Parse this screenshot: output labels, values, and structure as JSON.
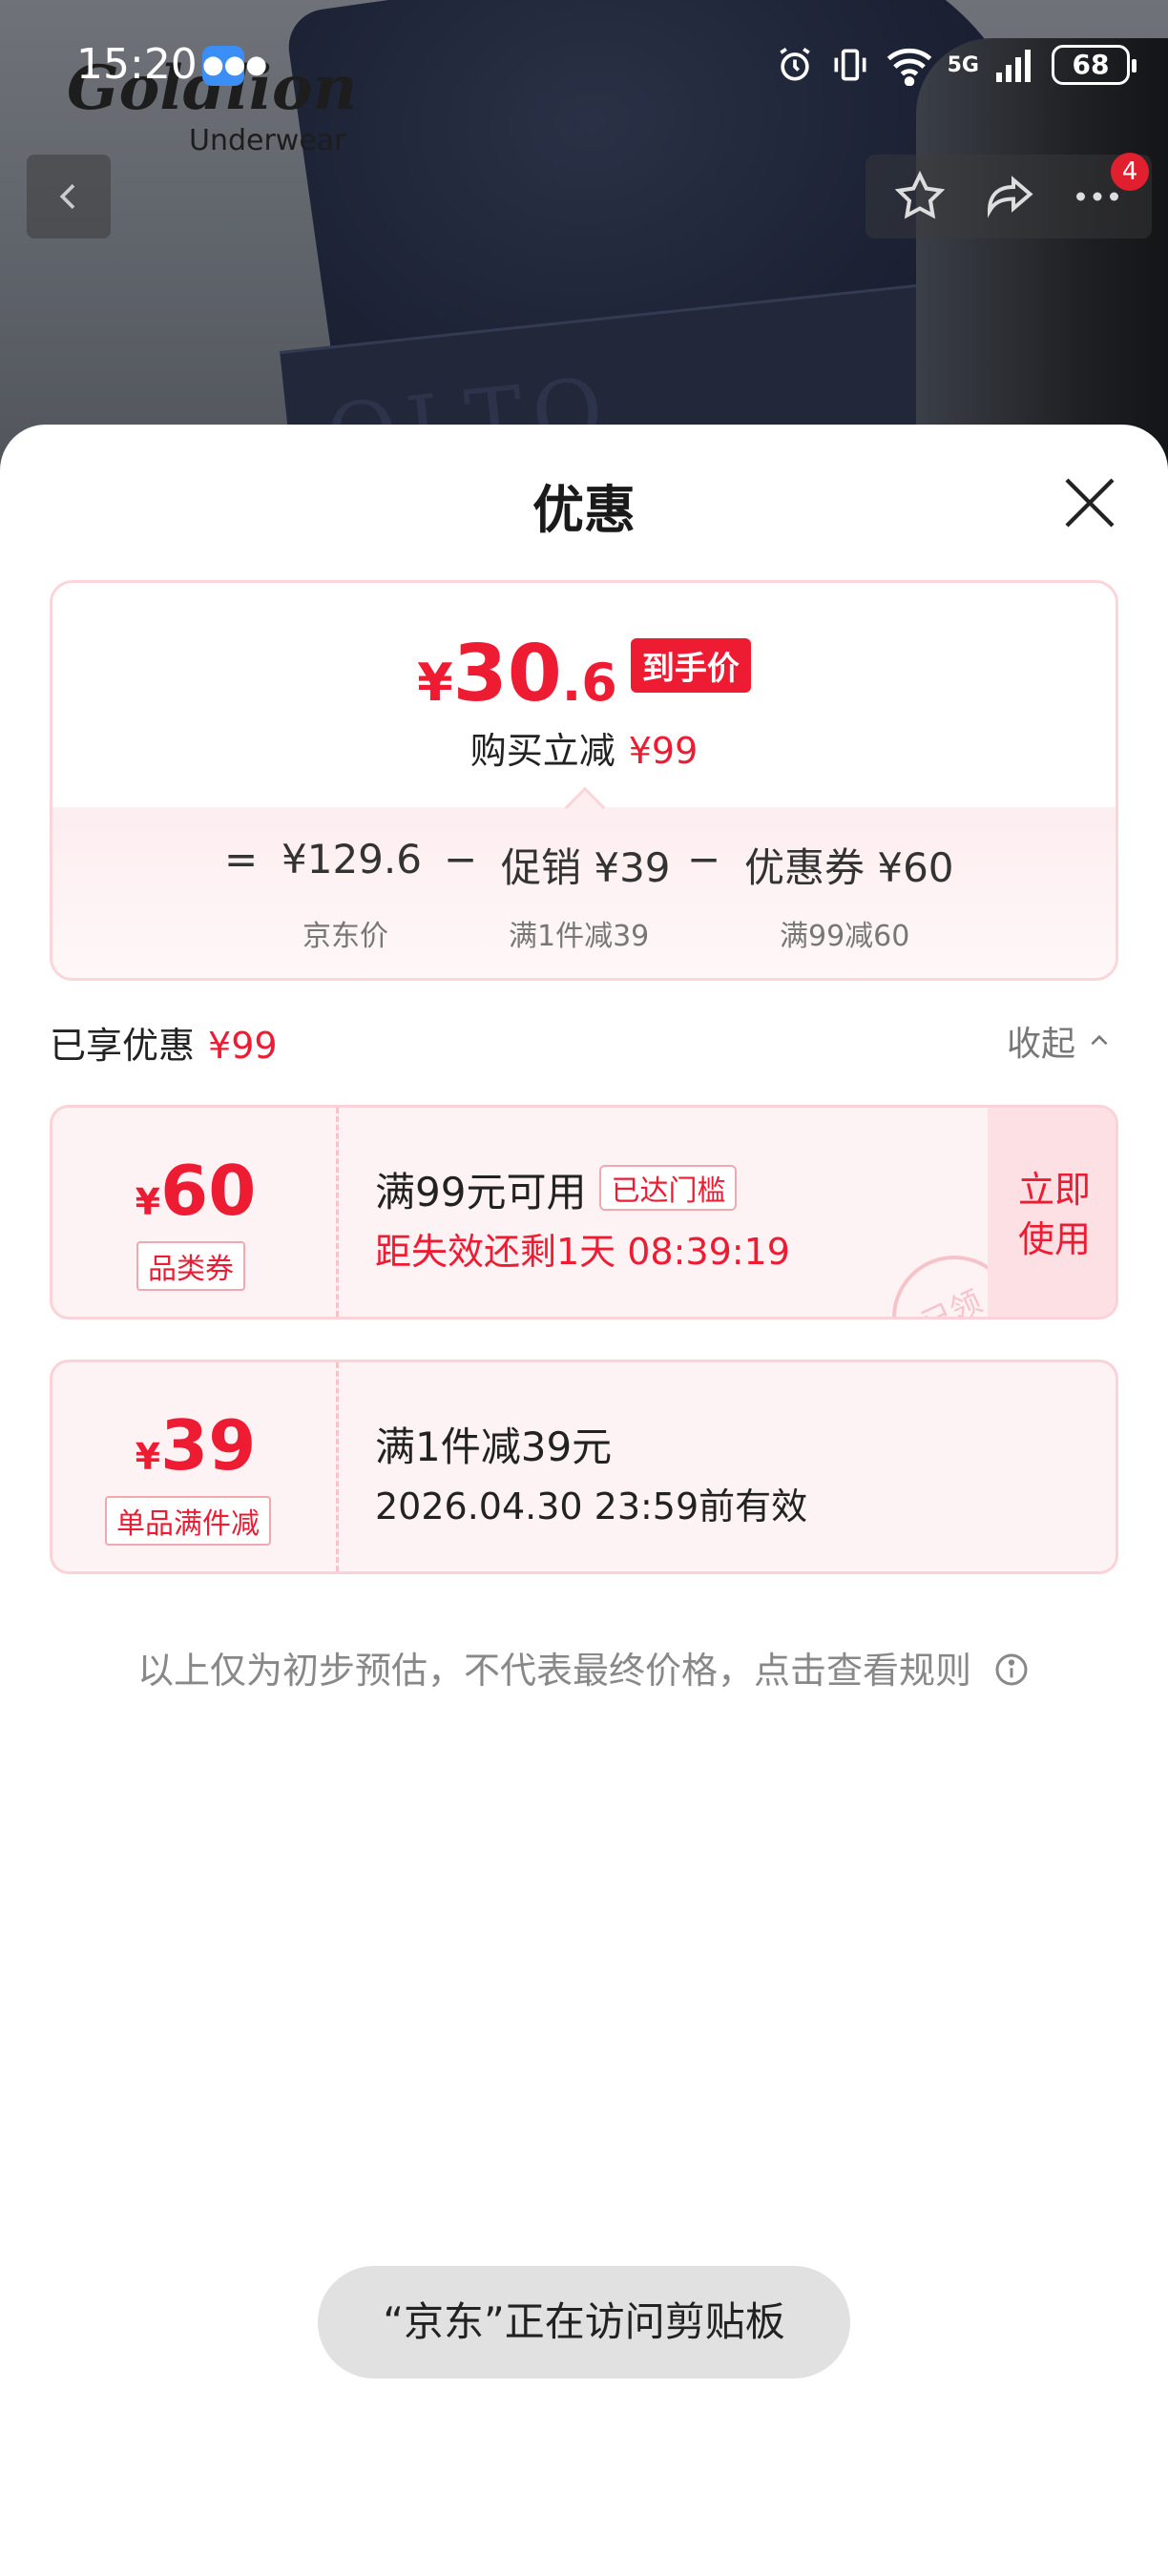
{
  "status_bar": {
    "time": "15:20",
    "network": "5G",
    "battery": "68"
  },
  "background": {
    "brand_script": "Goldlion",
    "brand_sub": "Underwear",
    "band_text": "OLTO",
    "cart_badge": "4"
  },
  "sheet": {
    "title": "优惠",
    "final_price": {
      "yen": "¥",
      "integer": "30",
      "decimal": ".6",
      "tag": "到手价"
    },
    "saved": {
      "label": "购买立减",
      "amount": "¥99"
    },
    "calc": {
      "equals": "=",
      "jd_price": "¥129.6",
      "jd_price_label": "京东价",
      "minus1": "−",
      "promo": "促销 ¥39",
      "promo_label": "满1件减39",
      "minus2": "−",
      "coupon": "优惠券 ¥60",
      "coupon_label": "满99减60"
    },
    "enjoyed": {
      "label": "已享优惠",
      "amount": "¥99"
    },
    "collapse_label": "收起",
    "coupons": [
      {
        "yen": "¥",
        "value": "60",
        "type": "品类券",
        "main": "满99元可用",
        "tag": "已达门槛",
        "sub": "距失效还剩1天 08:39:19",
        "action": "立即使用",
        "stamp": "已领"
      },
      {
        "yen": "¥",
        "value": "39",
        "type": "单品满件减",
        "main": "满1件减39元",
        "sub": "2026.04.30 23:59前有效"
      }
    ],
    "disclaimer": "以上仅为初步预估，不代表最终价格，点击查看规则"
  },
  "toast": "“京东”正在访问剪贴板",
  "colors": {
    "accent": "#ee1c33",
    "coupon_bg": "#fef3f4"
  }
}
